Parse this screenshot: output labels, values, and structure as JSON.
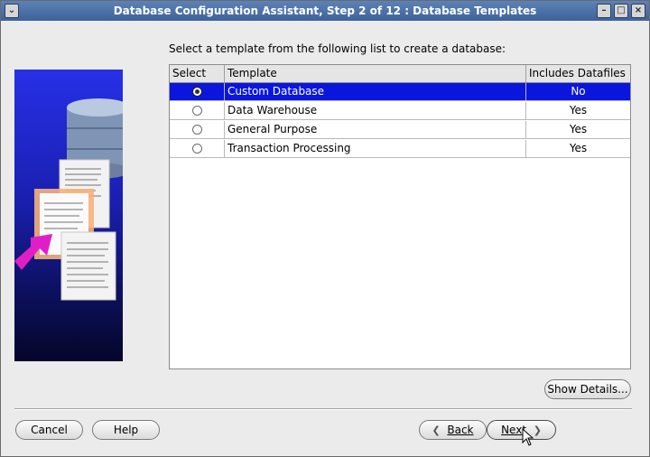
{
  "window": {
    "title": "Database Configuration Assistant, Step 2 of 12 : Database Templates",
    "menu_icon": "chevron-down-icon",
    "minimize_icon": "minimize-icon",
    "maximize_icon": "maximize-icon",
    "close_icon": "close-icon"
  },
  "instruction": "Select a template from the following list to create a database:",
  "table": {
    "headers": {
      "select": "Select",
      "template": "Template",
      "includes": "Includes Datafiles"
    },
    "rows": [
      {
        "template": "Custom Database",
        "includes": "No",
        "selected": true
      },
      {
        "template": "Data Warehouse",
        "includes": "Yes",
        "selected": false
      },
      {
        "template": "General Purpose",
        "includes": "Yes",
        "selected": false
      },
      {
        "template": "Transaction Processing",
        "includes": "Yes",
        "selected": false
      }
    ]
  },
  "buttons": {
    "show_details": "Show Details...",
    "cancel": "Cancel",
    "help": "Help",
    "back": "Back",
    "next": "Next"
  },
  "colors": {
    "title_bar": "#4a6fa5",
    "selection": "#0a16dc",
    "art_background": "#2730e6"
  }
}
